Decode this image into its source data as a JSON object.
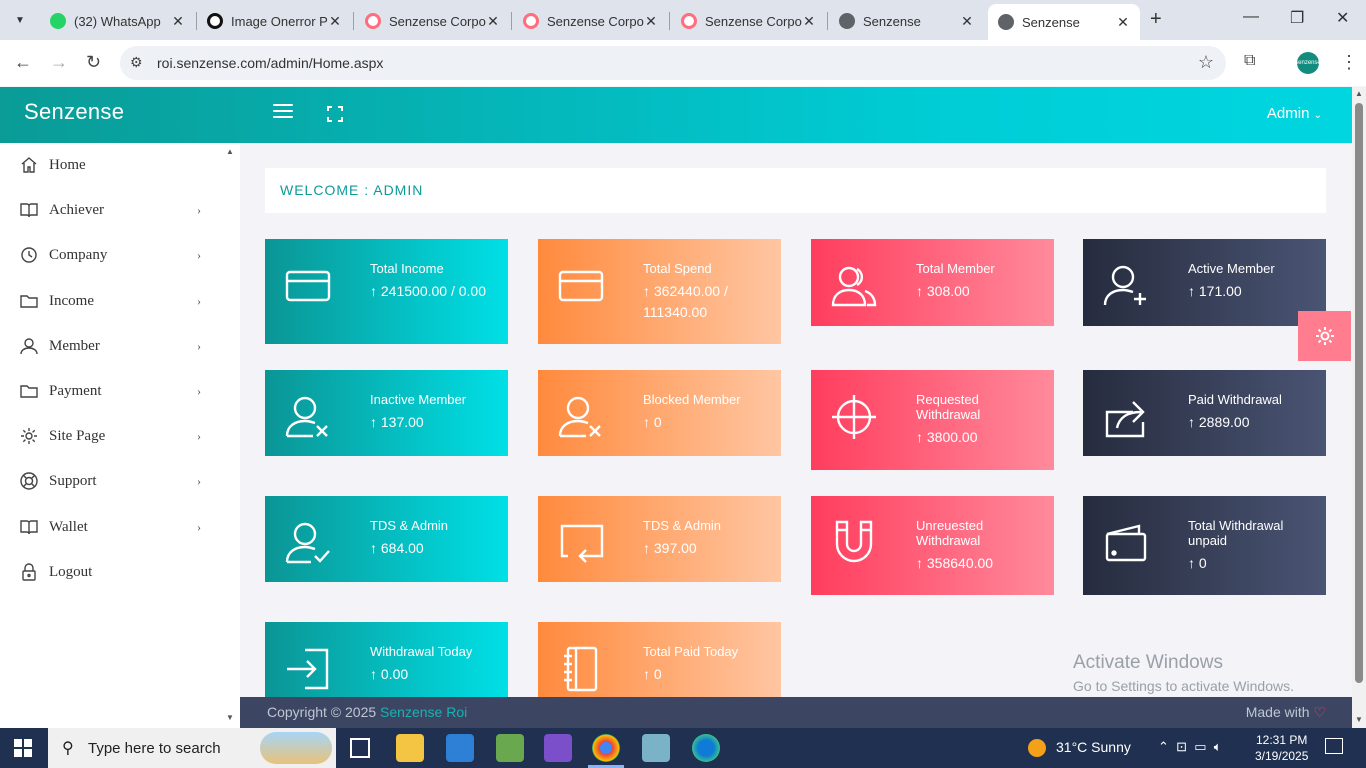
{
  "browser": {
    "tabs": [
      {
        "title": "(32) WhatsApp",
        "icon": "whatsapp-icon",
        "color": "#25d366"
      },
      {
        "title": "Image Onerror P",
        "icon": "chatgpt-icon",
        "color": "#111111"
      },
      {
        "title": "Senzense Corpo",
        "icon": "senzense-icon",
        "color": "#ff6d7e"
      },
      {
        "title": "Senzense Corpo",
        "icon": "senzense-icon",
        "color": "#ff6d7e"
      },
      {
        "title": "Senzense Corpo",
        "icon": "senzense-icon",
        "color": "#ff6d7e"
      },
      {
        "title": "Senzense",
        "icon": "globe-icon",
        "color": "#5f6368"
      },
      {
        "title": "Senzense",
        "icon": "globe-icon",
        "color": "#5f6368"
      }
    ],
    "active_tab_index": 6,
    "url": "roi.senzense.com/admin/Home.aspx",
    "profile_label": "senzense"
  },
  "app": {
    "brand": "Senzense",
    "user_menu": "Admin",
    "welcome": "WELCOME : ADMIN"
  },
  "sidebar": {
    "items": [
      {
        "label": "Home",
        "icon": "home-icon",
        "has_submenu": false
      },
      {
        "label": "Achiever",
        "icon": "book-icon",
        "has_submenu": true
      },
      {
        "label": "Company",
        "icon": "history-icon",
        "has_submenu": true
      },
      {
        "label": "Income",
        "icon": "folder-icon",
        "has_submenu": true
      },
      {
        "label": "Member",
        "icon": "user-icon",
        "has_submenu": true
      },
      {
        "label": "Payment",
        "icon": "folder-icon",
        "has_submenu": true
      },
      {
        "label": "Site Page",
        "icon": "gear-icon",
        "has_submenu": true
      },
      {
        "label": "Support",
        "icon": "lifebuoy-icon",
        "has_submenu": true
      },
      {
        "label": "Wallet",
        "icon": "book-icon",
        "has_submenu": true
      },
      {
        "label": "Logout",
        "icon": "lock-icon",
        "has_submenu": false
      }
    ]
  },
  "cards": [
    {
      "title": "Total Income",
      "value": "↑ 241500.00 / 0.00",
      "icon": "credit-card-icon",
      "theme": "teal"
    },
    {
      "title": "Total Spend",
      "value": "↑ 362440.00 / 111340.00",
      "icon": "credit-card-icon",
      "theme": "orange"
    },
    {
      "title": "Total Member",
      "value": "↑ 308.00",
      "icon": "users-icon",
      "theme": "pink"
    },
    {
      "title": "Active Member",
      "value": "↑ 171.00",
      "icon": "user-plus-icon",
      "theme": "navy"
    },
    {
      "title": "Inactive Member",
      "value": "↑ 137.00",
      "icon": "user-x-icon",
      "theme": "teal"
    },
    {
      "title": "Blocked Member",
      "value": "↑ 0",
      "icon": "user-x-icon",
      "theme": "orange"
    },
    {
      "title": "Requested Withdrawal",
      "value": "↑ 3800.00",
      "icon": "crosshair-icon",
      "theme": "pink"
    },
    {
      "title": "Paid Withdrawal",
      "value": "↑ 2889.00",
      "icon": "share-icon",
      "theme": "navy"
    },
    {
      "title": "TDS & Admin",
      "value": "↑ 684.00",
      "icon": "user-check-icon",
      "theme": "teal"
    },
    {
      "title": "TDS & Admin",
      "value": "↑ 397.00",
      "icon": "screen-return-icon",
      "theme": "orange"
    },
    {
      "title": "Unreuested Withdrawal",
      "value": "↑ 358640.00",
      "icon": "magnet-icon",
      "theme": "pink"
    },
    {
      "title": "Total Withdrawal unpaid",
      "value": "↑ 0",
      "icon": "wallet-icon",
      "theme": "navy"
    },
    {
      "title": "Withdrawal Today",
      "value": "↑ 0.00",
      "icon": "sign-in-icon",
      "theme": "teal"
    },
    {
      "title": "Total Paid Today",
      "value": "↑ 0",
      "icon": "notebook-icon",
      "theme": "orange"
    }
  ],
  "watermark": {
    "line1": "Activate Windows",
    "line2": "Go to Settings to activate Windows."
  },
  "footer": {
    "copyright": "Copyright © 2025",
    "brand_link": "Senzense Roi",
    "made_with": "Made with"
  },
  "taskbar": {
    "search_placeholder": "Type here to search",
    "weather": "31°C  Sunny",
    "time": "12:31 PM",
    "date": "3/19/2025"
  },
  "colors": {
    "teal": "#0b9595",
    "orange": "#ff8a3d",
    "pink": "#ff3d5e",
    "navy": "#262c3e",
    "accent": "#00cdd6"
  }
}
